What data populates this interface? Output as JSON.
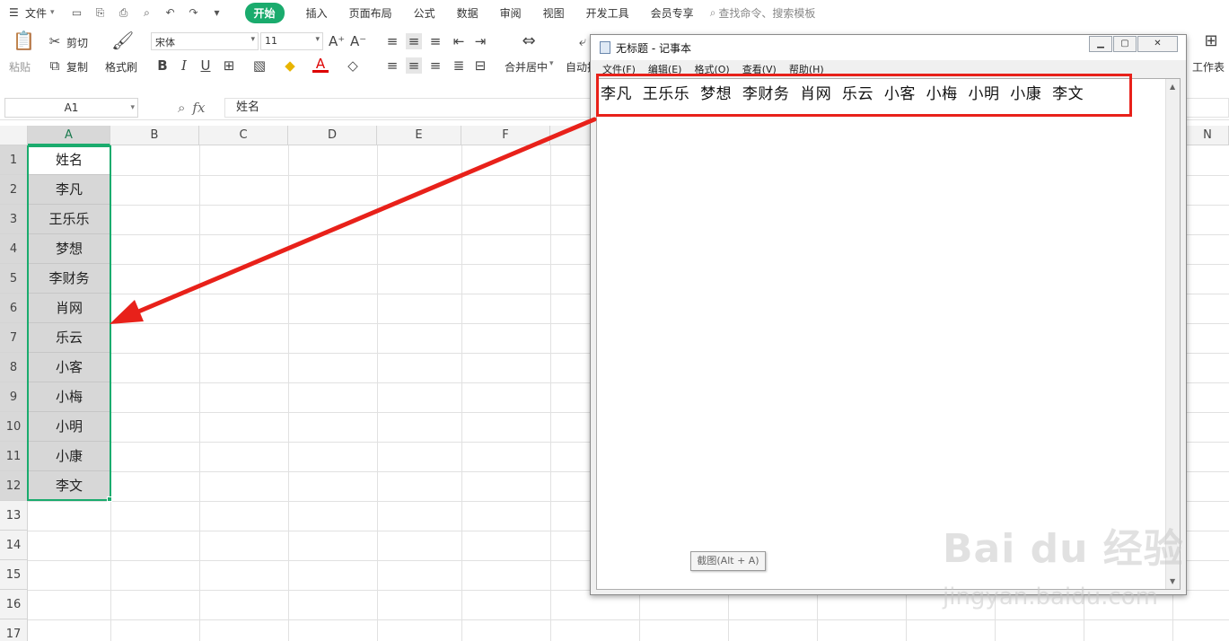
{
  "menubar": {
    "file_label": "文件",
    "tabs": [
      "开始",
      "插入",
      "页面布局",
      "公式",
      "数据",
      "审阅",
      "视图",
      "开发工具",
      "会员专享"
    ],
    "active_tab": "开始",
    "search_placeholder": "查找命令、搜索模板"
  },
  "ribbon": {
    "paste_label": "粘贴",
    "cut_label": "剪切",
    "copy_label": "复制",
    "format_painter_label": "格式刷",
    "font_name": "宋体",
    "font_size": "11",
    "bold": "B",
    "italic": "I",
    "underline": "U",
    "merge_center_label": "合并居中",
    "wrap_label": "自动换",
    "sheet_label": "工作表"
  },
  "formula_bar": {
    "name_box": "A1",
    "fx": "fx",
    "content": "姓名"
  },
  "grid": {
    "columns": [
      "A",
      "B",
      "C",
      "D",
      "E",
      "F",
      "N"
    ],
    "rows": [
      "1",
      "2",
      "3",
      "4",
      "5",
      "6",
      "7",
      "8",
      "9",
      "10",
      "11",
      "12",
      "13",
      "14",
      "15",
      "16",
      "17"
    ],
    "column_a_values": [
      "姓名",
      "李凡",
      "王乐乐",
      "梦想",
      "李财务",
      "肖网",
      "乐云",
      "小客",
      "小梅",
      "小明",
      "小康",
      "李文"
    ]
  },
  "notepad": {
    "title": "无标题 - 记事本",
    "menu": [
      "文件(F)",
      "编辑(E)",
      "格式(O)",
      "查看(V)",
      "帮助(H)"
    ],
    "content": "李凡  王乐乐  梦想  李财务  肖网  乐云  小客  小梅  小明  小康  李文",
    "tooltip": "截图(Alt + A)"
  },
  "watermark": {
    "brand": "Bai du 经验",
    "url": "jingyan.baidu.com"
  },
  "colors": {
    "accent_green": "#1aab6d",
    "highlight_red": "#e8211a"
  }
}
